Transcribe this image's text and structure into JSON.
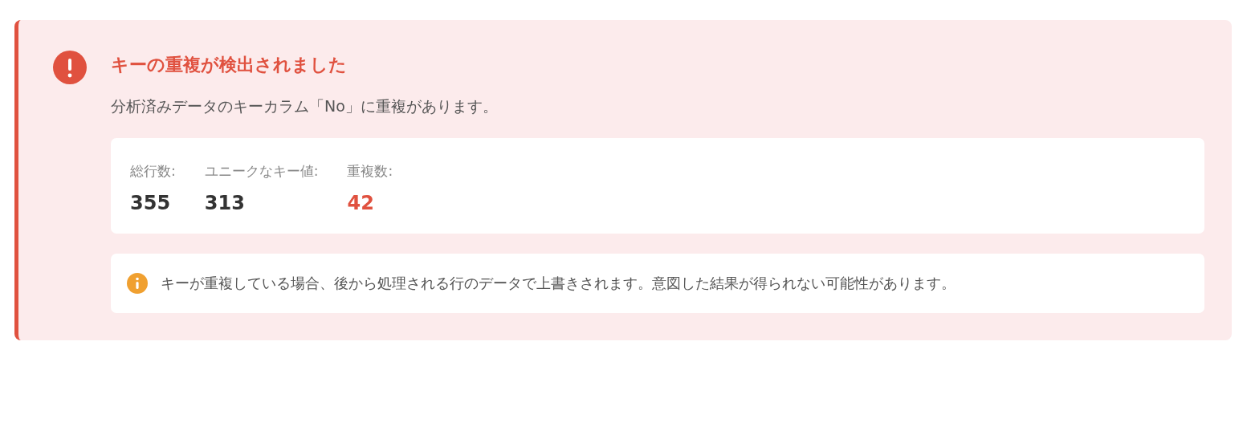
{
  "alert": {
    "title": "キーの重複が検出されました",
    "message": "分析済みデータのキーカラム「No」に重複があります。",
    "stats": [
      {
        "label": "総行数:",
        "value": "355",
        "color": "#333333"
      },
      {
        "label": "ユニークなキー値:",
        "value": "313",
        "color": "#333333"
      },
      {
        "label": "重複数:",
        "value": "42",
        "color": "#e0513f"
      }
    ],
    "note": "キーが重複している場合、後から処理される行のデータで上書きされます。意図した結果が得られない可能性があります。"
  }
}
